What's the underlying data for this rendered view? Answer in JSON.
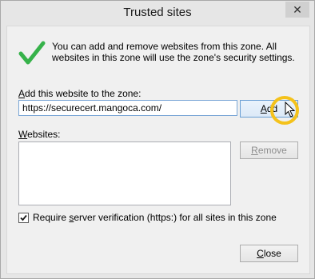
{
  "window": {
    "title": "Trusted sites",
    "close_glyph": "✕"
  },
  "info": {
    "icon": "green-checkmark-icon",
    "text": "You can add and remove websites from this zone. All websites in this zone will use the zone's security settings."
  },
  "add_section": {
    "label_pre": "",
    "label_access": "A",
    "label_post": "dd this website to the zone:",
    "input_value": "https://securecert.mangoca.com/",
    "add_button_access": "A",
    "add_button_rest": "dd"
  },
  "websites": {
    "label_access": "W",
    "label_post": "ebsites:",
    "items": [],
    "remove_access": "R",
    "remove_rest": "emove"
  },
  "verification": {
    "checked": true,
    "label_pre": "Require ",
    "label_access": "s",
    "label_post": "erver verification (https:) for all sites in this zone"
  },
  "footer": {
    "close_access": "C",
    "close_rest": "lose"
  },
  "colors": {
    "check_green": "#36b24a",
    "highlight": "#f4c21b",
    "disabled_text": "#8d8d8d"
  }
}
